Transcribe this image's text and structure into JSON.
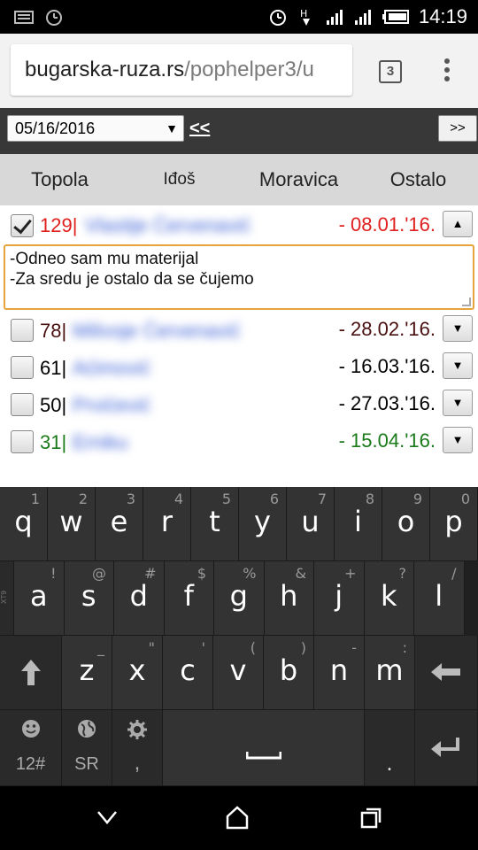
{
  "status_bar": {
    "time": "14:19",
    "icons": [
      "keyboard-icon",
      "alarm-clock-icon",
      "alarm-clock-icon",
      "data-transfer-icon",
      "signal-icon",
      "signal-icon",
      "battery-icon"
    ]
  },
  "browser": {
    "url_host": "bugarska-ruza.rs",
    "url_path": "/pophelper3/u",
    "tab_count": "3"
  },
  "toolbar": {
    "date_value": "05/16/2016",
    "prev_label": "<<",
    "next_label": ">>"
  },
  "tabs": [
    "Topola",
    "Iđoš",
    "Moravica",
    "Ostalo"
  ],
  "list": {
    "items": [
      {
        "number": "129|",
        "name": "Vlastije Ćervenavić",
        "date": "- 08.01.'16.",
        "checked": true,
        "arrow": "▲"
      },
      {
        "number": "78|",
        "name": "Milivoje Ćervenavić",
        "date": "- 28.02.'16.",
        "checked": false,
        "arrow": "▼"
      },
      {
        "number": "61|",
        "name": "Aćimović",
        "date": "- 16.03.'16.",
        "checked": false,
        "arrow": "▼"
      },
      {
        "number": "50|",
        "name": "Prvićević",
        "date": "- 27.03.'16.",
        "checked": false,
        "arrow": "▼"
      },
      {
        "number": "31|",
        "name": "Erniku",
        "date": "- 15.04.'16.",
        "checked": false,
        "arrow": "▼"
      }
    ],
    "note_text": "-Odneo sam mu materijal\n-Za sredu je ostalo da se čujemo"
  },
  "keyboard": {
    "row1": [
      {
        "k": "q",
        "h": "1"
      },
      {
        "k": "w",
        "h": "2"
      },
      {
        "k": "e",
        "h": "3"
      },
      {
        "k": "r",
        "h": "4"
      },
      {
        "k": "t",
        "h": "5"
      },
      {
        "k": "y",
        "h": "6"
      },
      {
        "k": "u",
        "h": "7"
      },
      {
        "k": "i",
        "h": "8"
      },
      {
        "k": "o",
        "h": "9"
      },
      {
        "k": "p",
        "h": "0"
      }
    ],
    "row2": [
      {
        "k": "a",
        "h": "!"
      },
      {
        "k": "s",
        "h": "@"
      },
      {
        "k": "d",
        "h": "#"
      },
      {
        "k": "f",
        "h": "$"
      },
      {
        "k": "g",
        "h": "%"
      },
      {
        "k": "h",
        "h": "&"
      },
      {
        "k": "j",
        "h": "+"
      },
      {
        "k": "k",
        "h": "?"
      },
      {
        "k": "l",
        "h": "/"
      }
    ],
    "row3": [
      {
        "k": "z",
        "h": "_"
      },
      {
        "k": "x",
        "h": "\""
      },
      {
        "k": "c",
        "h": "'"
      },
      {
        "k": "v",
        "h": "("
      },
      {
        "k": "b",
        "h": ")"
      },
      {
        "k": "n",
        "h": "-"
      },
      {
        "k": "m",
        "h": ":"
      }
    ],
    "symbols_label": "12#",
    "language_label": "SR",
    "comma_label": ",",
    "period_label": ".",
    "side_label": "XT9"
  },
  "colors": {
    "accent_orange": "#e7a43b",
    "date_red": "#e0201e",
    "date_green": "#1a7a1a",
    "name_blue": "#3a5fd6",
    "toolbar_bg": "#383838",
    "tabs_bg": "#d8d8d8",
    "keyboard_bg": "#202020"
  }
}
